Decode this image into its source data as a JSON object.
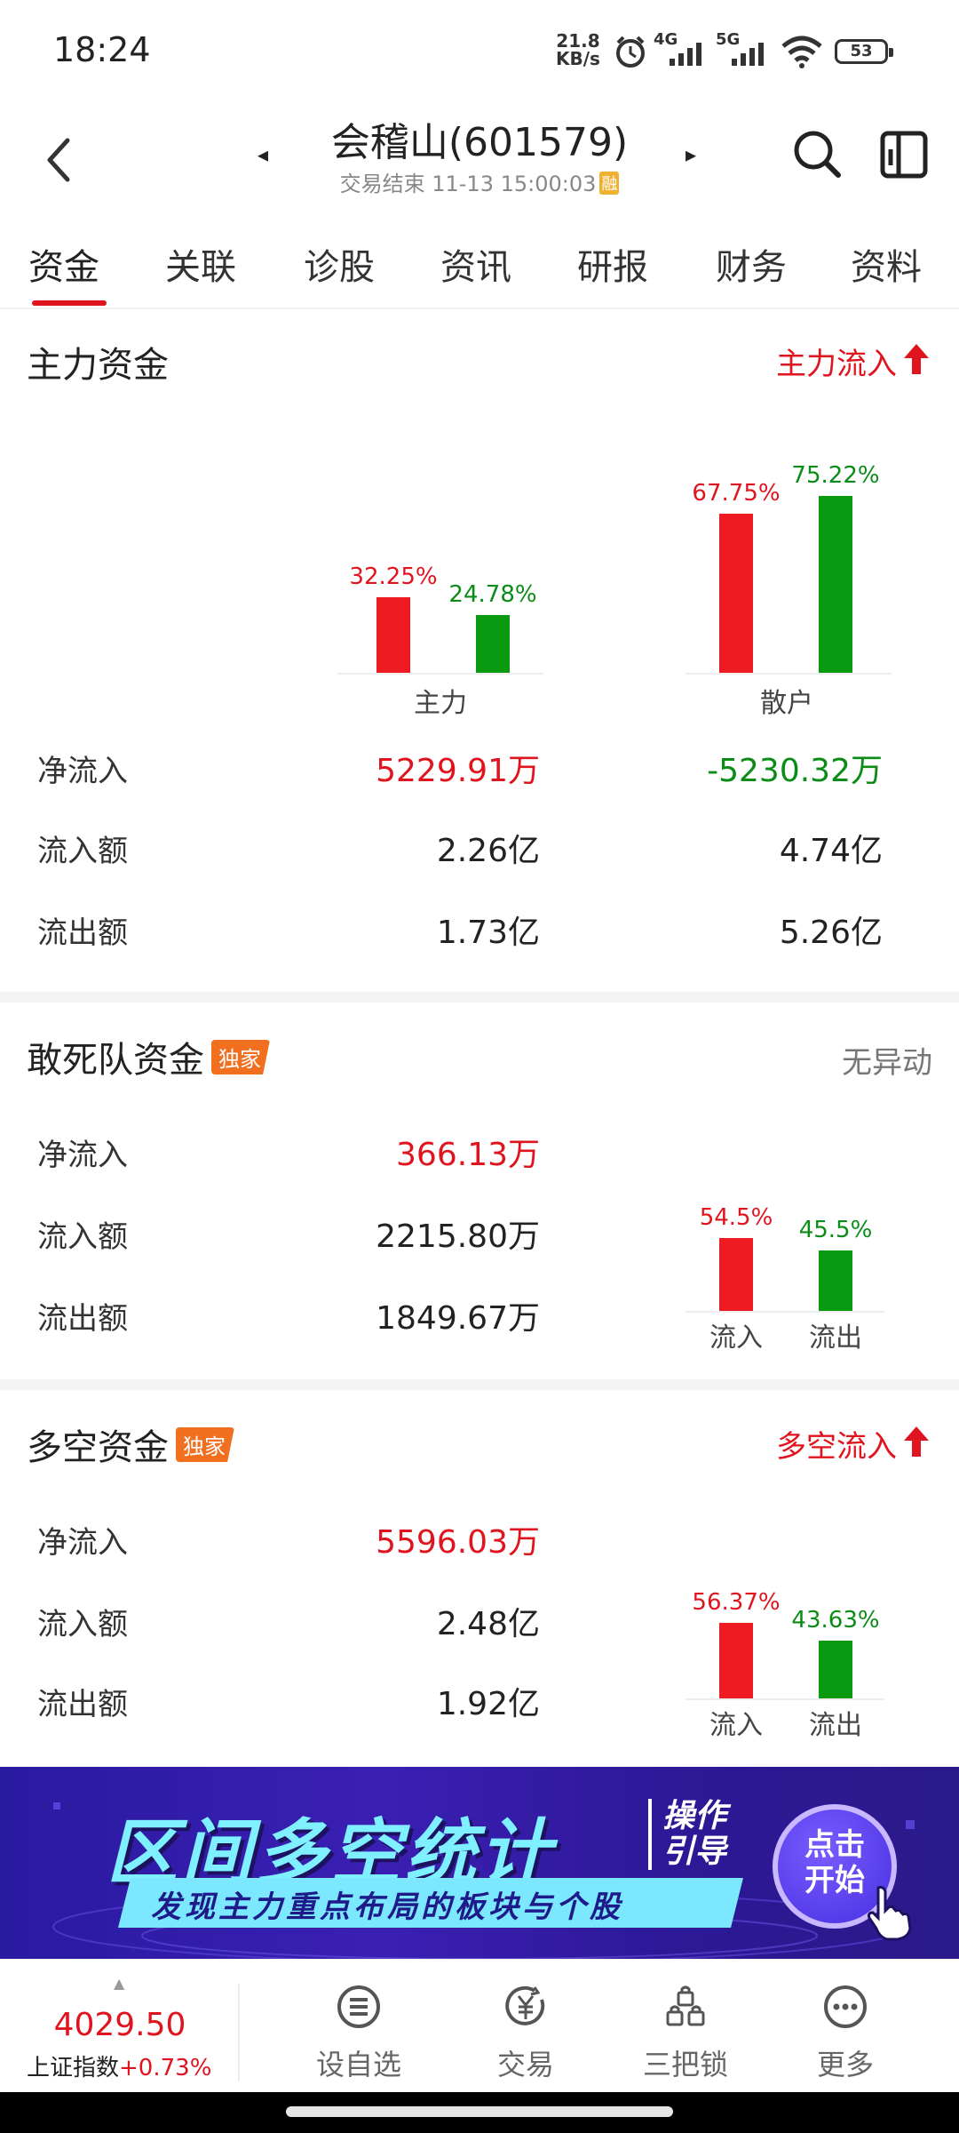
{
  "status_bar": {
    "time": "18:24",
    "net_speed_value": "21.8",
    "net_speed_unit": "KB/s",
    "signal1": "4G",
    "signal2": "5G",
    "battery": "53"
  },
  "header": {
    "title": "会稽山(601579)",
    "trade_status": "交易结束 11-13 15:00:03",
    "badge": "融"
  },
  "tabs": [
    "资金",
    "关联",
    "诊股",
    "资讯",
    "研报",
    "财务",
    "资料"
  ],
  "main_funds": {
    "title": "主力资金",
    "status": "主力流入",
    "chart_data": {
      "type": "bar",
      "categories": [
        "主力",
        "散户"
      ],
      "series": [
        {
          "values": [
            32.25,
            67.75
          ],
          "labels": [
            "32.25%",
            "67.75%"
          ],
          "color": "#ee1c22"
        },
        {
          "values": [
            24.78,
            75.22
          ],
          "labels": [
            "24.78%",
            "75.22%"
          ],
          "color": "#0a9a12"
        }
      ],
      "ylim": [
        0,
        100
      ]
    },
    "rows": [
      {
        "label": "净流入",
        "main": "5229.91万",
        "retail": "-5230.32万"
      },
      {
        "label": "流入额",
        "main": "2.26亿",
        "retail": "4.74亿"
      },
      {
        "label": "流出额",
        "main": "1.73亿",
        "retail": "5.26亿"
      }
    ]
  },
  "dare_squad": {
    "title": "敢死队资金",
    "tag": "独家",
    "status": "无异动",
    "rows": [
      {
        "label": "净流入",
        "value": "366.13万"
      },
      {
        "label": "流入额",
        "value": "2215.80万"
      },
      {
        "label": "流出额",
        "value": "1849.67万"
      }
    ],
    "chart_data": {
      "type": "bar",
      "categories": [
        "流入",
        "流出"
      ],
      "values": [
        54.5,
        45.5
      ],
      "labels": [
        "54.5%",
        "45.5%"
      ],
      "colors": [
        "#ee1c22",
        "#0a9a12"
      ],
      "ylim": [
        0,
        100
      ]
    }
  },
  "long_short": {
    "title": "多空资金",
    "tag": "独家",
    "status": "多空流入",
    "rows": [
      {
        "label": "净流入",
        "value": "5596.03万"
      },
      {
        "label": "流入额",
        "value": "2.48亿"
      },
      {
        "label": "流出额",
        "value": "1.92亿"
      }
    ],
    "chart_data": {
      "type": "bar",
      "categories": [
        "流入",
        "流出"
      ],
      "values": [
        56.37,
        43.63
      ],
      "labels": [
        "56.37%",
        "43.63%"
      ],
      "colors": [
        "#ee1c22",
        "#0a9a12"
      ],
      "ylim": [
        0,
        100
      ]
    }
  },
  "banner": {
    "title": "区间多空统计",
    "tag_line1": "操作",
    "tag_line2": "引导",
    "subtitle": "发现主力重点布局的板块与个股",
    "button_line1": "点击",
    "button_line2": "开始"
  },
  "bottom_bar": {
    "index_value": "4029.50",
    "index_name": "上证指数",
    "index_change": "+0.73%",
    "nav": [
      {
        "label": "设自选",
        "icon": "menu-circle-icon"
      },
      {
        "label": "交易",
        "icon": "yuan-icon"
      },
      {
        "label": "三把锁",
        "icon": "three-locks-icon"
      },
      {
        "label": "更多",
        "icon": "more-icon"
      }
    ]
  }
}
